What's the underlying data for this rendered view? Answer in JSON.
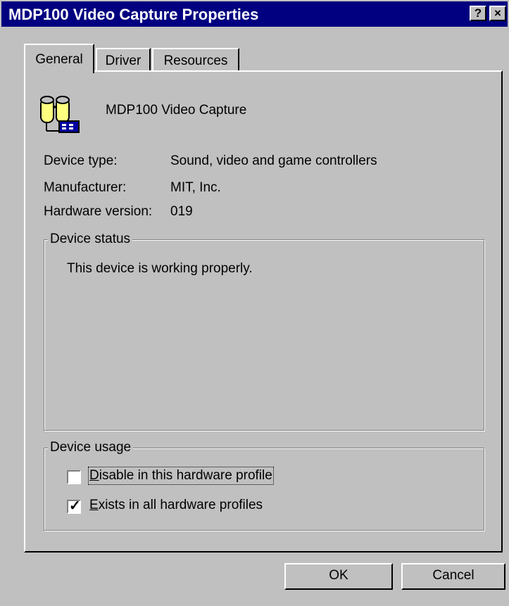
{
  "window": {
    "title": "MDP100 Video Capture Properties",
    "help_button": "?",
    "close_button": "×"
  },
  "tabs": [
    {
      "label": "General",
      "active": true
    },
    {
      "label": "Driver",
      "active": false
    },
    {
      "label": "Resources",
      "active": false
    }
  ],
  "device": {
    "name": "MDP100 Video Capture",
    "icon": "video-capture-device-icon",
    "type_label": "Device type:",
    "type_value": "Sound, video and game controllers",
    "manufacturer_label": "Manufacturer:",
    "manufacturer_value": "MIT, Inc.",
    "hardware_version_label": "Hardware version:",
    "hardware_version_value": "019"
  },
  "status": {
    "group_label": "Device status",
    "text": "This device is working properly."
  },
  "usage": {
    "group_label": "Device usage",
    "disable_label": "Disable in this hardware profile",
    "disable_checked": false,
    "exists_label": "Exists in all hardware profiles",
    "exists_checked": true
  },
  "buttons": {
    "ok": "OK",
    "cancel": "Cancel"
  },
  "colors": {
    "titlebar": "#000080",
    "face": "#c0c0c0"
  }
}
